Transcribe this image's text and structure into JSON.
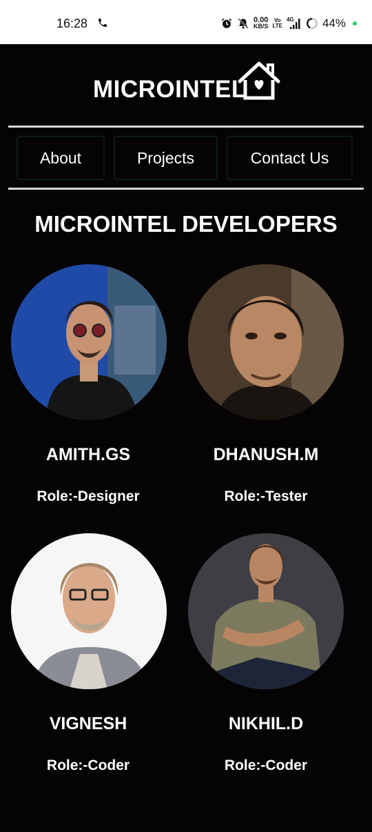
{
  "status_bar": {
    "time": "16:28",
    "net_speed_value": "0.00",
    "net_speed_unit": "KB/S",
    "volte_top": "Vo",
    "volte_bottom": "LTE",
    "network": "4G",
    "battery": "44%",
    "icons": [
      "phone-call-icon",
      "alarm-icon",
      "mute-bell-icon",
      "signal-icon",
      "battery-ring-icon"
    ]
  },
  "header": {
    "brand": "MICROINTEL",
    "logo_icon": "house-heart-icon"
  },
  "nav": {
    "about": "About",
    "projects": "Projects",
    "contact": "Contact Us"
  },
  "main": {
    "title": "MICROINTEL DEVELOPERS",
    "developers": [
      {
        "name": "AMITH.GS",
        "role": "Role:-Designer"
      },
      {
        "name": "DHANUSH.M",
        "role": "Role:-Tester"
      },
      {
        "name": "VIGNESH",
        "role": "Role:-Coder"
      },
      {
        "name": "NIKHIL.D",
        "role": "Role:-Coder"
      }
    ]
  },
  "colors": {
    "background": "#060304",
    "text": "#ffffff",
    "divider": "#d9d9d9"
  }
}
